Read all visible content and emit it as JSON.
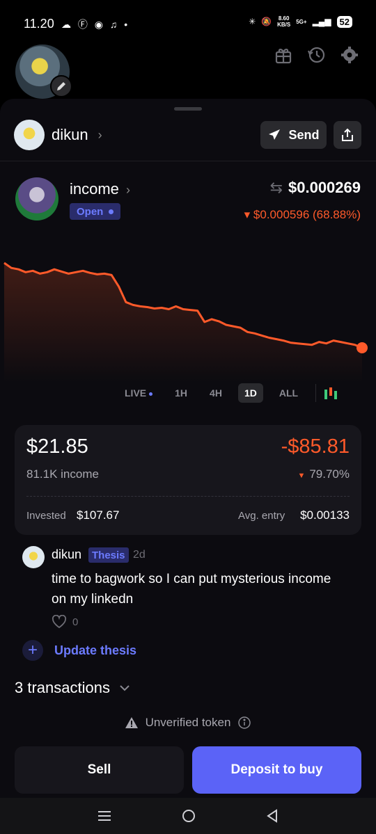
{
  "status_bar": {
    "time": "11.20",
    "app_icons": "☁ Ⓕ ◉ ♫ •",
    "net_speed_value": "8.60",
    "net_speed_unit": "KB/S",
    "network": "5G+",
    "battery": "52"
  },
  "header": {
    "icons": [
      "gift-icon",
      "history-icon",
      "settings-icon"
    ]
  },
  "user": {
    "name": "dikun",
    "send_label": "Send"
  },
  "token": {
    "name": "income",
    "status": "Open",
    "price": "$0.000269",
    "change": "▾ $0.000596 (68.88%)"
  },
  "chart_data": {
    "type": "line",
    "title": "",
    "xlabel": "",
    "ylabel": "",
    "series": [
      {
        "color": "#ff5a2a",
        "values": [
          0.000865,
          0.00083,
          0.00082,
          0.0008,
          0.00081,
          0.00079,
          0.0008,
          0.00082,
          0.000805,
          0.00079,
          0.0008,
          0.00081,
          0.000795,
          0.000785,
          0.00079,
          0.00078,
          0.0007,
          0.00059,
          0.00057,
          0.00056,
          0.000555,
          0.000545,
          0.00055,
          0.00054,
          0.00056,
          0.00054,
          0.000535,
          0.00053,
          0.00045,
          0.00047,
          0.000455,
          0.00043,
          0.00042,
          0.00041,
          0.00038,
          0.00037,
          0.000355,
          0.00034,
          0.00033,
          0.00032,
          0.000305,
          0.0003,
          0.000295,
          0.00029,
          0.00031,
          0.0003,
          0.00032,
          0.00031,
          0.0003,
          0.00029,
          0.000269
        ]
      }
    ],
    "grid": false,
    "legend": "none"
  },
  "range_selector": {
    "options": [
      "LIVE",
      "1H",
      "4H",
      "1D",
      "ALL"
    ],
    "selected": "1D"
  },
  "position": {
    "value": "$21.85",
    "pnl": "-$85.81",
    "quantity": "81.1K income",
    "pnl_pct": "79.70%",
    "invested_label": "Invested",
    "invested_value": "$107.67",
    "avg_entry_label": "Avg. entry",
    "avg_entry_value": "$0.00133"
  },
  "thesis": {
    "author": "dikun",
    "tag": "Thesis",
    "age": "2d",
    "text": "time to bagwork so I can put mysterious income on my linkedn",
    "likes": "0",
    "update_label": "Update thesis"
  },
  "transactions": {
    "label": "3 transactions"
  },
  "warning": {
    "label": "Unverified token"
  },
  "actions": {
    "sell_label": "Sell",
    "buy_label": "Deposit to buy"
  },
  "colors": {
    "accent": "#5b63f7",
    "loss": "#ff5a2a",
    "background": "#0c0b10"
  }
}
